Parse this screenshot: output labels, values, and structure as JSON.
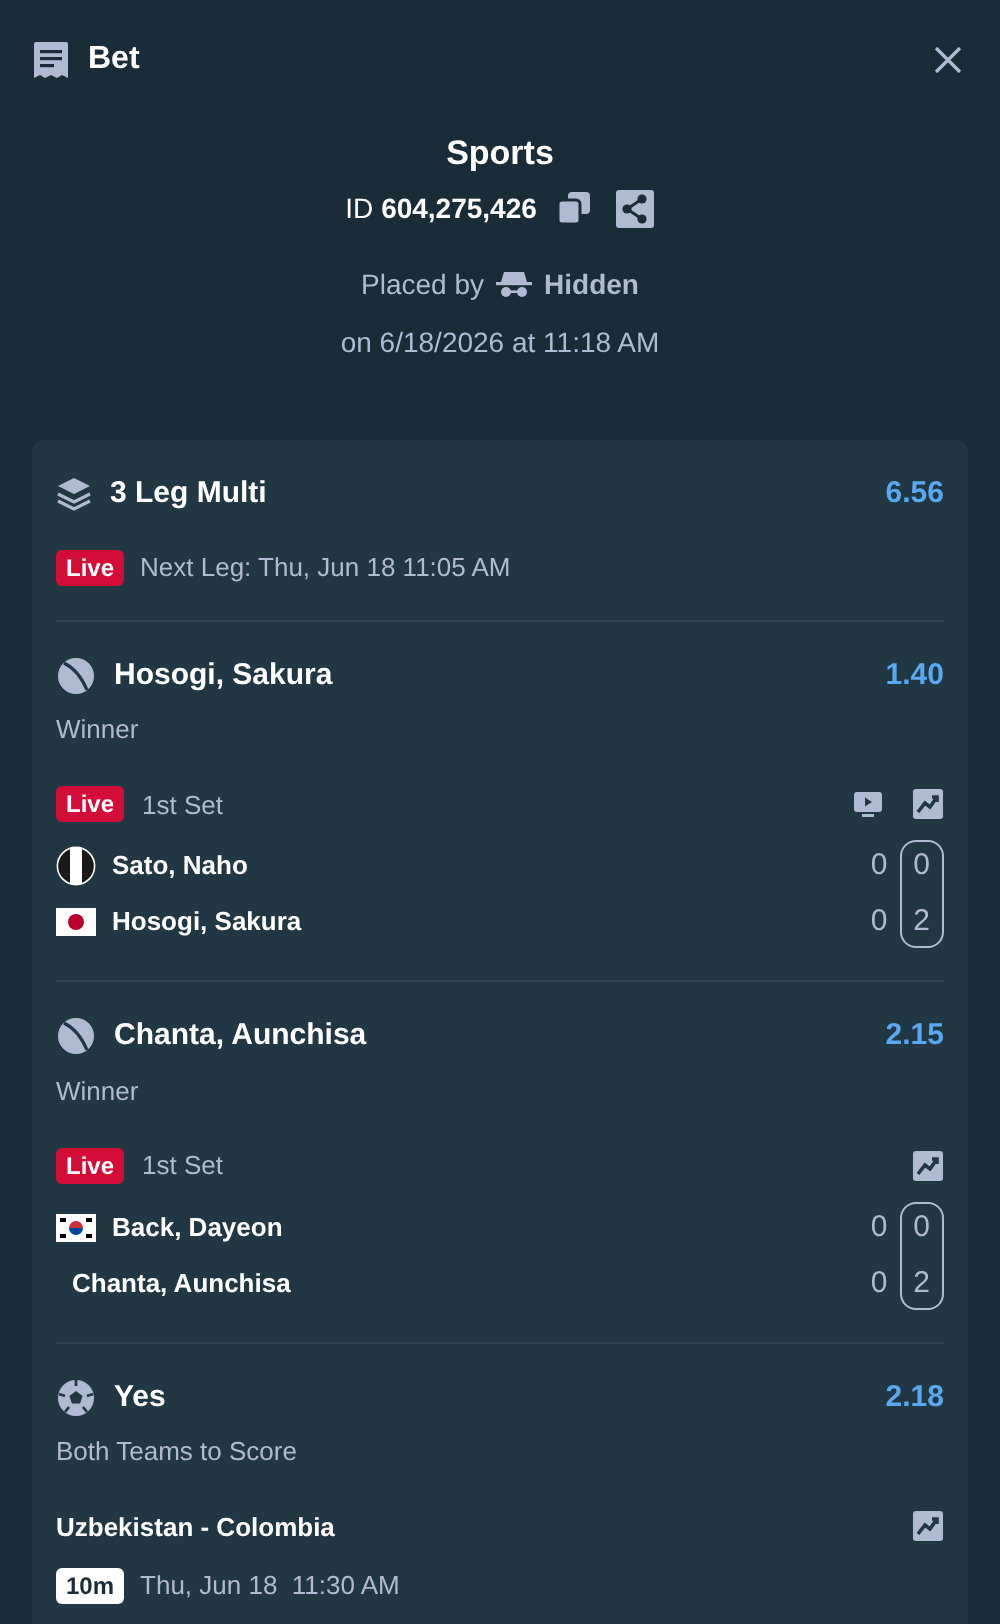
{
  "header": {
    "title": "Bet"
  },
  "summary": {
    "sport": "Sports",
    "id_label": "ID",
    "id": "604,275,426",
    "placed_by": "Placed by",
    "user": "Hidden",
    "date": "on 6/18/2026 at 11:18 AM"
  },
  "multi": {
    "title": "3 Leg Multi",
    "odds": "6.56",
    "badge": {
      "kind": "live",
      "text": "Live"
    },
    "next": "Next Leg: Thu, Jun 18 11:05 AM"
  },
  "legs": [
    {
      "kind": "tennis",
      "selection": "Hosogi, Sakura",
      "odds": "1.40",
      "market": "Winner",
      "badge": {
        "kind": "live",
        "text": "Live"
      },
      "period": "1st Set",
      "actions": [
        {
          "kind": "tv"
        },
        {
          "kind": "chart"
        }
      ],
      "players": [
        {
          "name": "Sato, Naho",
          "flag": {
            "kind": "stripes"
          },
          "score_1": "0",
          "score_2": "0"
        },
        {
          "name": "Hosogi, Sakura",
          "flag": {
            "kind": "japan"
          },
          "score_1": "0",
          "score_2": "2"
        }
      ]
    },
    {
      "kind": "tennis",
      "selection": "Chanta, Aunchisa",
      "odds": "2.15",
      "market": "Winner",
      "badge": {
        "kind": "live",
        "text": "Live"
      },
      "period": "1st Set",
      "actions": [
        {
          "kind": "chart"
        }
      ],
      "players": [
        {
          "name": "Back, Dayeon",
          "flag": {
            "kind": "korea"
          },
          "score_1": "0",
          "score_2": "0"
        },
        {
          "name": "Chanta, Aunchisa",
          "score_1": "0",
          "score_2": "2"
        }
      ]
    },
    {
      "kind": "soccer",
      "selection": "Yes",
      "odds": "2.18",
      "market": "Both Teams to Score",
      "match": "Uzbekistan - Colombia",
      "actions": [
        {
          "kind": "chart"
        }
      ],
      "badge": {
        "kind": "countdown",
        "text": "10m"
      },
      "time": "Thu, Jun 18  11:30 AM"
    }
  ]
}
